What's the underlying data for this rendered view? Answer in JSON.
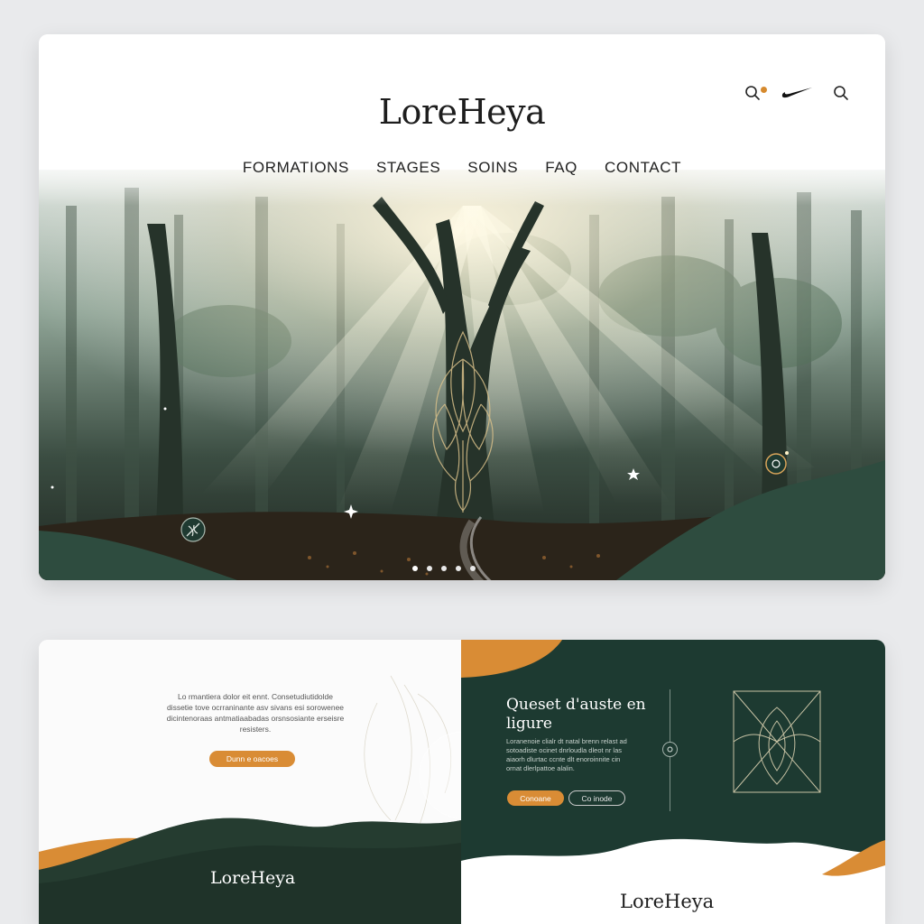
{
  "site": {
    "brand": "LoreHeya"
  },
  "nav": {
    "items": [
      "FORMATIONS",
      "STAGES",
      "SOINS",
      "FAQ",
      "CONTACT"
    ]
  },
  "header_icons": [
    "search-icon",
    "swoosh-icon",
    "search-icon"
  ],
  "hero": {
    "slides_total": 5,
    "slide_active": 1
  },
  "section_left": {
    "text": "Lo rmantiera dolor eit ennt. Consetudiutidolde dissetie tove ocrraninante asv sivans esi sorowenee dicintenoraas antmatiaabadas orsnsosiante erseisre resisters.",
    "button_label": "Dunn e oacoes",
    "brand": "LoreHeya"
  },
  "section_right": {
    "title": "Queset d'auste en ligure",
    "text": "Loranenoie clialr dt natal brenn relast ad sotoadiste ocinet dnrloudla dleot nr las aiaorh dlurtac ccnte dlt enoroinnite cin ornat dlerlpattoe alalin.",
    "primary_button": "Conoane",
    "secondary_button": "Co inode",
    "brand": "LoreHeya"
  },
  "colors": {
    "accent": "#d98c35",
    "forest": "#1d3a31",
    "page_bg": "#e9eaec"
  }
}
